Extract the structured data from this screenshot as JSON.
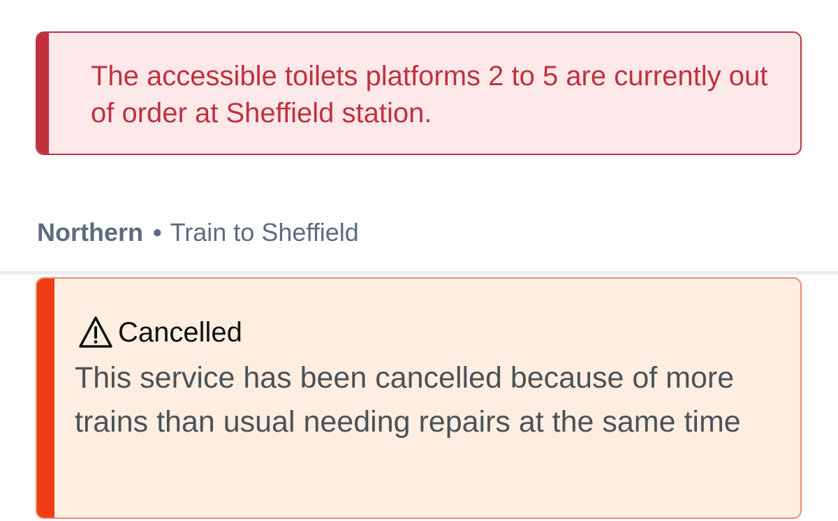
{
  "station_notice": {
    "text": "The accessible toilets platforms 2 to 5 are currently out of order at Sheffield station.",
    "color": "#c0313d",
    "background": "#fde8ea"
  },
  "service": {
    "operator": "Northern",
    "separator": "•",
    "description": "Train to Sheffield"
  },
  "cancellation": {
    "icon": "warning-triangle-icon",
    "title": "Cancelled",
    "message": "This service has been cancelled because of more trains than usual needing repairs at the same time",
    "accent_color": "#ef3c13",
    "background": "#fdeee1"
  }
}
